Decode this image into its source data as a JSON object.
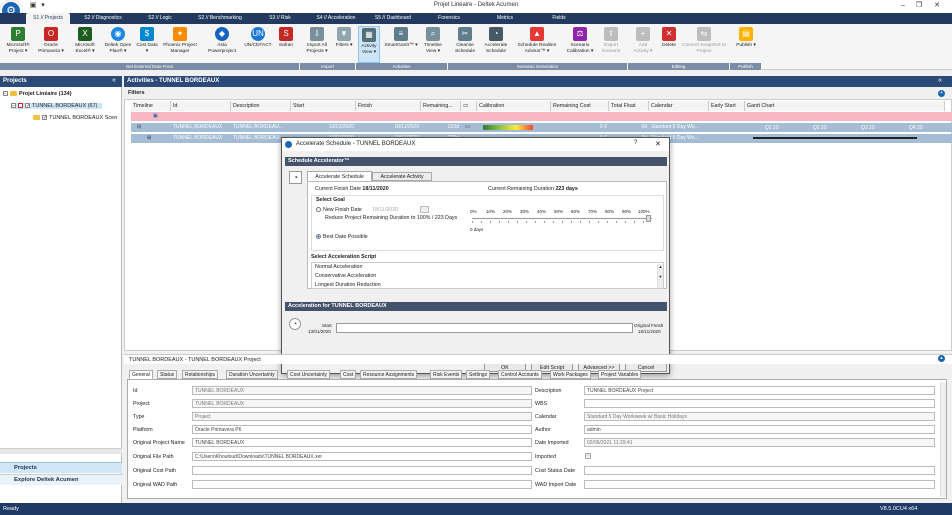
{
  "window": {
    "title": "Projet Linéaire - Deltek Acumen"
  },
  "tabs": [
    "S1 // Projects",
    "S2 // Diagnostics",
    "S2 // Logic",
    "S2 // Benchmarking",
    "S3 // Risk",
    "S4 // Acceleration",
    "S5 // Dashboard",
    "Forensics",
    "Metrics",
    "Fields"
  ],
  "ribbon": {
    "buttons": [
      {
        "label": "Microsoft® Project ▾",
        "icon": "ms-project-icon",
        "color": "#2e7d32"
      },
      {
        "label": "Oracle Primavera ▾",
        "icon": "oracle-icon",
        "color": "#c62828"
      },
      {
        "label": "Microsoft Excel® ▾",
        "icon": "excel-icon",
        "color": "#1b5e20"
      },
      {
        "label": "Deltek Open Plan® ▾",
        "icon": "open-plan-icon",
        "color": "#1e88e5"
      },
      {
        "label": "Cost Data ▾",
        "icon": "cost-data-icon",
        "color": "#0288d1"
      },
      {
        "label": "Phoenix Project Manager",
        "icon": "phoenix-icon",
        "color": "#fb8c00"
      },
      {
        "label": "Asta Powerproject",
        "icon": "asta-icon",
        "color": "#1565c0"
      },
      {
        "label": "UN/CEFACT",
        "icon": "uncefact-icon",
        "color": "#1976d2"
      },
      {
        "label": "Safran",
        "icon": "safran-icon",
        "color": "#c62828"
      },
      {
        "label": "Import All Projects ▾",
        "icon": "import-all-icon",
        "color": "#78909c"
      },
      {
        "label": "Filters ▾",
        "icon": "filter-icon",
        "color": "#90a4ae"
      },
      {
        "label": "Activity View ▾",
        "icon": "activity-view-icon",
        "color": "#546e7a"
      },
      {
        "label": "SmartGantt™ ▾",
        "icon": "smartgantt-icon",
        "color": "#607d8b"
      },
      {
        "label": "Timeline View ▾",
        "icon": "timeline-view-icon",
        "color": "#78909c"
      },
      {
        "label": "Cleanse Schedule",
        "icon": "cleanse-icon",
        "color": "#607d8b"
      },
      {
        "label": "Accelerate Schedule",
        "icon": "accelerate-icon",
        "color": "#455a64"
      },
      {
        "label": "Schedule Realism Advisor™ ▾",
        "icon": "realism-icon",
        "color": "#e53935"
      },
      {
        "label": "Scenario Calibration ▾",
        "icon": "calibration-icon",
        "color": "#8e24aa"
      },
      {
        "label": "Export Scenario",
        "icon": "export-scenario-icon",
        "color": "#bdbdbd"
      },
      {
        "label": "Add Activity ▾",
        "icon": "add-activity-icon",
        "color": "#bdbdbd"
      },
      {
        "label": "Delete",
        "icon": "delete-icon",
        "color": "#d32f2f"
      },
      {
        "label": "Convert Snapshot to Project",
        "icon": "convert-icon",
        "color": "#bdbdbd"
      },
      {
        "label": "Publish ▾",
        "icon": "publish-icon",
        "color": "#ffb300"
      }
    ],
    "groups": [
      "Get External Data From",
      "Import",
      "Activities",
      "Scenario Generation",
      "Editing",
      "Publish"
    ]
  },
  "projects_panel": {
    "title": "Projects",
    "tree": [
      "Projet Linéaire (134)",
      "TUNNEL BORDEAUX (67)",
      "TUNNEL BORDEAUX Scen"
    ],
    "nav": [
      "Projects",
      "Explore Deltek Acumen"
    ]
  },
  "activities": {
    "title": "Activities - TUNNEL BORDEAUX",
    "filters_label": "Filters",
    "columns": [
      "Timeline",
      "Id",
      "Description",
      "Start",
      "Finish",
      "Remaining...",
      "Calibration",
      "Remaining Cost",
      "Total Float",
      "Calendar",
      "Early Start",
      "Gantt Chart"
    ],
    "rows": [
      {
        "id": "TUNNEL BORDEAUX",
        "desc": "TUNNEL BORDEAU...",
        "start": "13/01/2020",
        "finish": "18/11/2020",
        "remaining": "223d",
        "cost": "0 €",
        "float": "0d",
        "calendar": "Standard 5 Day Wo..."
      },
      {
        "id": "TUNNEL BORDEAUX",
        "desc": "TUNNEL BORDEAU...",
        "start": "13/01/2020",
        "finish": "18/11/2020",
        "remaining": "223d",
        "cost": "0 €",
        "float": "0d",
        "calendar": "Standard 5 Day Wo..."
      }
    ],
    "gantt_quarters": [
      "Q1 20",
      "Q2 20",
      "Q3 20",
      "Q4 20"
    ]
  },
  "dialog": {
    "title": "Accelerate Schedule - TUNNEL BORDEAUX",
    "help": "?",
    "close": "✕",
    "section_title": "Schedule Accelerator™",
    "tabs": [
      "Accelerate Schedule",
      "Accelerate Activity"
    ],
    "current_finish_label": "Current Finish Date",
    "current_finish": "18/11/2020",
    "current_remaining_label": "Current Remaining Duration",
    "current_remaining": "223 days",
    "select_goal": "Select Goal",
    "new_finish_label": "New Finish Date",
    "new_finish_value": "18/11/2020",
    "reduce_label": "Reduce Project Remaining Duration to 100% / 223 Days",
    "best_date_label": "Best Date Possible",
    "slider_ticks": [
      "0%",
      "10%",
      "20%",
      "30%",
      "40%",
      "50%",
      "60%",
      "70%",
      "80%",
      "90%",
      "100%"
    ],
    "slider_days": "0 days",
    "script_title": "Select Acceleration Script",
    "scripts": [
      "Normal Acceleration",
      "Conservative Acceleration",
      "Longest Duration Reduction"
    ],
    "accel_section": "Acceleration for TUNNEL BORDEAUX",
    "start_label": "Start",
    "start_date": "13/01/2020",
    "orig_finish_label": "Original Finish",
    "orig_finish_date": "18/11/2020",
    "buttons": [
      "OK",
      "Edit Script",
      "Advanced >>",
      "Cancel"
    ]
  },
  "details": {
    "header": "TUNNEL BORDEAUX - TUNNEL BORDEAUX Project",
    "tabs": [
      "General",
      "Status",
      "Relationships",
      "Duration Uncertainty",
      "Cost Uncertainty",
      "Cost",
      "Resource Assignments",
      "Risk Events",
      "Settings",
      "Control Accounts",
      "Work Packages",
      "Project Variables"
    ],
    "left_fields": [
      {
        "label": "Id",
        "value": "TUNNEL BORDEAUX"
      },
      {
        "label": "Project",
        "value": "TUNNEL BORDEAUX"
      },
      {
        "label": "Type",
        "value": "Project"
      },
      {
        "label": "Platform",
        "value": "Oracle Primavera P6"
      },
      {
        "label": "Original Project Name",
        "value": "TUNNEL BORDEAUX"
      },
      {
        "label": "Original File Path",
        "value": "C:\\Users\\Khouloud\\Downloads\\TUNNEL BORDEAUX.xer"
      },
      {
        "label": "Original Cost Path",
        "value": ""
      },
      {
        "label": "Original WAD Path",
        "value": ""
      }
    ],
    "right_fields": [
      {
        "label": "Description",
        "value": "TUNNEL BORDEAUX Project"
      },
      {
        "label": "WBS",
        "value": ""
      },
      {
        "label": "Calendar",
        "value": "Standard 5 Day Workweek w/ Basic Holidays"
      },
      {
        "label": "Author",
        "value": "admin"
      },
      {
        "label": "Date Imported",
        "value": "02/06/2021 11:29:41"
      },
      {
        "label": "Imported",
        "value": ""
      },
      {
        "label": "Cost Status Date",
        "value": ""
      },
      {
        "label": "WAD Import Date",
        "value": ""
      }
    ]
  },
  "status": {
    "left": "Ready",
    "right": "V8.5.0CU4 x64"
  }
}
